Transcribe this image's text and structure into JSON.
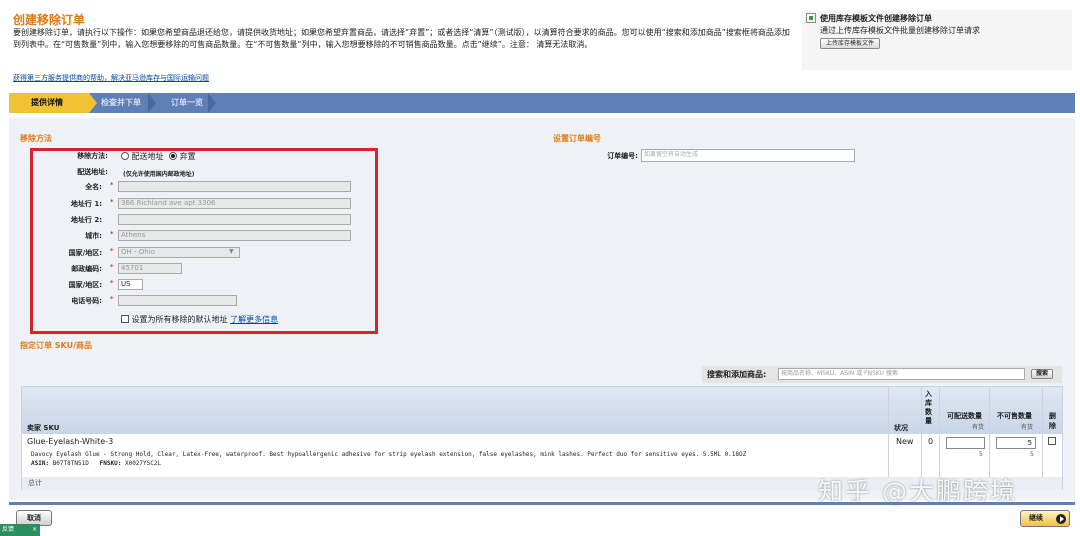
{
  "header": {
    "title": "创建移除订单",
    "description": "要创建移除订单，请执行以下操作：如果您希望商品退还给您，请提供收货地址；如果您希望弃置商品，请选择“弃置”；或者选择“清算”（测试版），以清算符合要求的商品。您可以使用“搜索和添加商品”搜索框将商品添加到列表中。在“可售数量”列中，输入您想要移除的可售商品数量。在“不可售数量”列中，输入您想要移除的不可销售商品数量。点击“继续”。注意： 清算无法取消。",
    "help_link": "获得第三方服务提供商的帮助，解决亚马逊库存与国际运输问题"
  },
  "template_box": {
    "title": "使用库存模板文件创建移除订单",
    "subtitle": "通过上传库存模板文件批量创建移除订单请求",
    "button": "上传库存模板文件"
  },
  "steps": [
    {
      "label": "提供详情",
      "active": true
    },
    {
      "label": "检查并下单",
      "active": false
    },
    {
      "label": "订单一览",
      "active": false
    }
  ],
  "removal_method": {
    "section_title": "移除方法",
    "method_label": "移除方法:",
    "option_ship": "配送地址",
    "option_dispose": "弃置",
    "selected": "弃置",
    "address_label": "配送地址:",
    "address_note": "(仅允许使用国内邮政地址)",
    "fields": {
      "full_name": {
        "label": "全名:",
        "value": ""
      },
      "address1": {
        "label": "地址行 1:",
        "value": "366 Richland ave apt 3306"
      },
      "address2": {
        "label": "地址行 2:",
        "value": ""
      },
      "city": {
        "label": "城市:",
        "value": "Athens"
      },
      "state": {
        "label": "国家/地区:",
        "value": "OH - Ohio"
      },
      "zip": {
        "label": "邮政编码:",
        "value": "45701"
      },
      "country": {
        "label": "国家/地区:",
        "value": "US"
      },
      "phone": {
        "label": "电话号码:",
        "value": ""
      }
    },
    "default_checkbox": "设置为所有移除的默认地址",
    "learn_more": "了解更多信息"
  },
  "order_id": {
    "section_title": "设置订单编号",
    "label": "订单编号:",
    "placeholder": "如果留空将自动生成"
  },
  "sku_section": {
    "title": "指定订单 SKU/商品",
    "search_label": "搜索和添加商品:",
    "search_placeholder": "按商品名称、MSKU、ASIN 或 FNSKU 搜索",
    "search_button": "搜索"
  },
  "table": {
    "headers": {
      "sku": "卖家 SKU",
      "condition": "状况",
      "inbound": "入库数量",
      "sellable": "可配送数量",
      "sellable_sub": "有货",
      "unsellable": "不可售数量",
      "unsellable_sub": "有货",
      "delete": "删除"
    },
    "rows": [
      {
        "sku": "Glue-Eyelash-White-3",
        "title": "Davocy Eyelash Glue - Strong Hold, Clear, Latex-Free, waterproof. Best hypoallergenic adhesive for strip eyelash extension, false eyelashes, mink lashes. Perfect duo for sensitive eyes. 5.5ML 0.18OZ",
        "asin_label": "ASIN:",
        "asin": "B07T8TN51D",
        "fnsku_label": "FNSKU:",
        "fnsku": "X0027YSC2L",
        "condition": "New",
        "inbound": "0",
        "sellable_input": "",
        "sellable_available": "5",
        "unsellable_input": "5",
        "unsellable_available": "5"
      }
    ],
    "total_label": "总计"
  },
  "footer": {
    "cancel": "取消",
    "continue": "继续",
    "feedback": "反馈",
    "feedback_close": "×"
  },
  "watermark": "知乎 @大鹏跨境",
  "colors": {
    "accent_orange": "#e47911",
    "step_bar_blue": "#5f7fb7",
    "active_step_yellow": "#f1c232",
    "highlight_red": "#d8232a"
  }
}
